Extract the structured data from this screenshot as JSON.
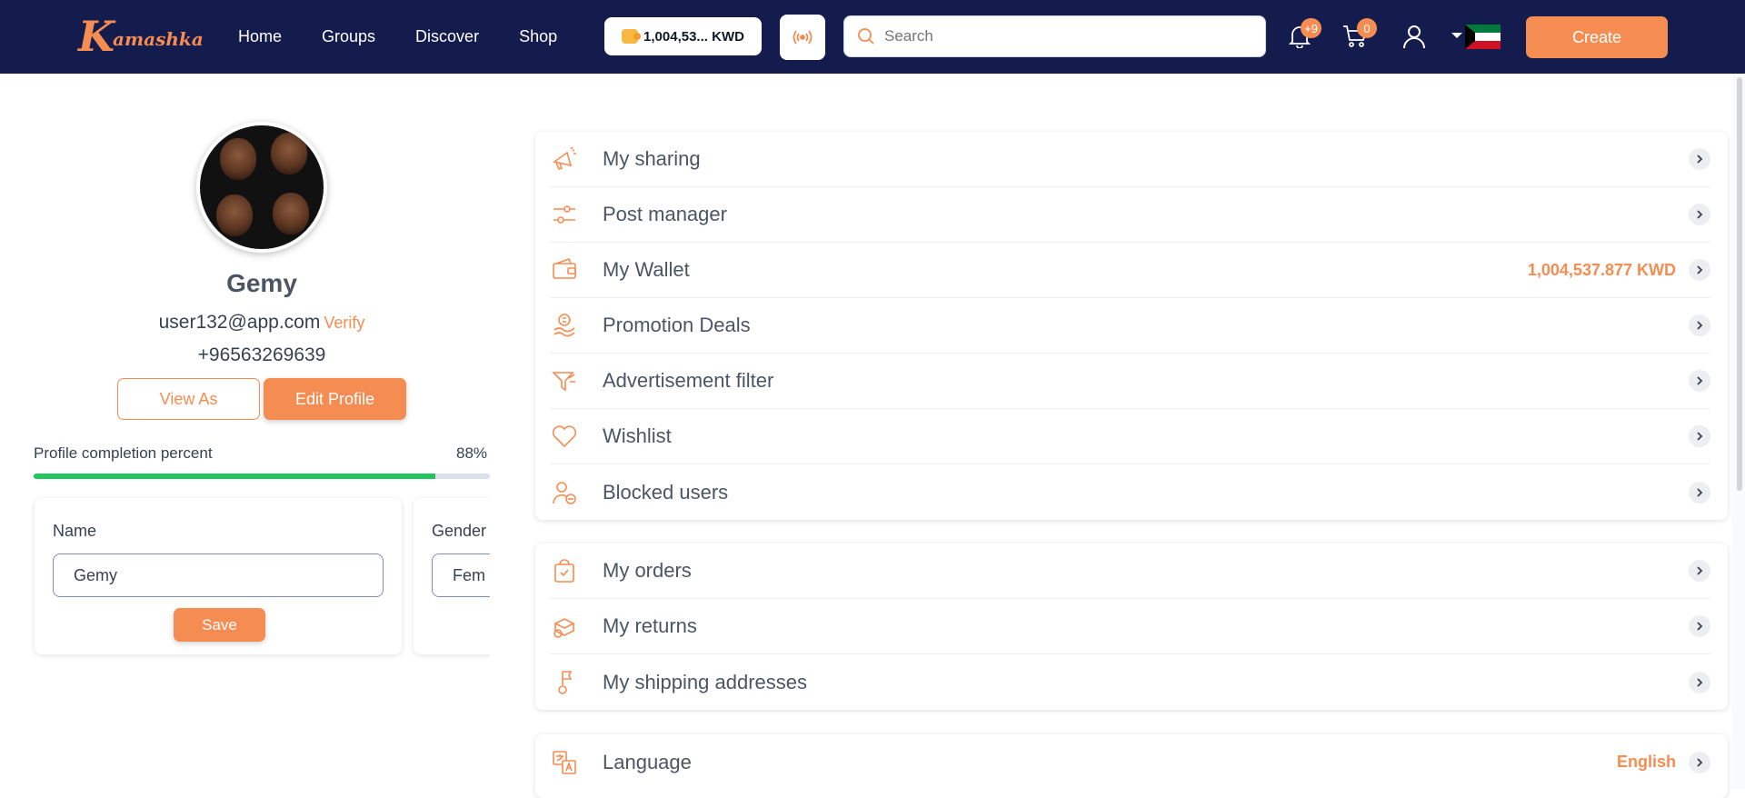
{
  "header": {
    "logo_k": "K",
    "logo_rest": "amashka",
    "nav": [
      "Home",
      "Groups",
      "Discover",
      "Shop"
    ],
    "balance": "1,004,53... KWD",
    "search_placeholder": "Search",
    "notifications_count": "+9",
    "cart_count": "0",
    "create_label": "Create",
    "accent": "#f58c52",
    "bg": "#141b4d"
  },
  "profile": {
    "name": "Gemy",
    "email": "user132@app.com",
    "verify_label": "Verify",
    "phone": "+96563269639",
    "view_as_label": "View As",
    "edit_profile_label": "Edit Profile",
    "completion_label": "Profile completion percent",
    "completion_value": "88%",
    "completion_fraction": 0.88
  },
  "fields": [
    {
      "label": "Name",
      "value": "Gemy",
      "save_label": "Save"
    },
    {
      "label": "Gender",
      "value": "Fem"
    }
  ],
  "menu_group_1": [
    {
      "label": "My sharing",
      "icon": "megaphone-icon",
      "value": ""
    },
    {
      "label": "Post manager",
      "icon": "sliders-icon",
      "value": ""
    },
    {
      "label": "My Wallet",
      "icon": "wallet-icon",
      "value": "1,004,537.877 KWD"
    },
    {
      "label": "Promotion Deals",
      "icon": "money-icon",
      "value": ""
    },
    {
      "label": "Advertisement filter",
      "icon": "filter-icon",
      "value": ""
    },
    {
      "label": "Wishlist",
      "icon": "heart-icon",
      "value": ""
    },
    {
      "label": "Blocked users",
      "icon": "blocked-user-icon",
      "value": ""
    }
  ],
  "menu_group_2": [
    {
      "label": "My orders",
      "icon": "shopping-bag-icon",
      "value": ""
    },
    {
      "label": "My returns",
      "icon": "returns-icon",
      "value": ""
    },
    {
      "label": "My shipping addresses",
      "icon": "location-pin-icon",
      "value": ""
    }
  ],
  "menu_group_3": [
    {
      "label": "Language",
      "icon": "translate-icon",
      "value": "English"
    }
  ]
}
